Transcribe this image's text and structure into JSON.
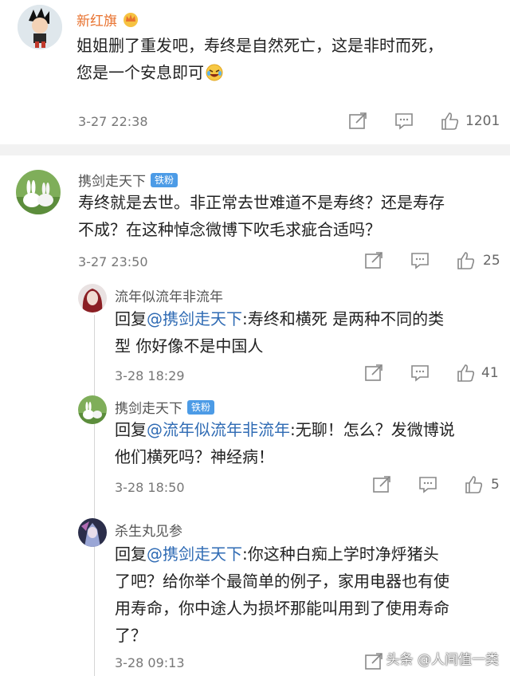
{
  "comments": [
    {
      "username": "新红旗",
      "text_1": "姐姐删了重发吧，寿终是自然死亡，这是非时而死，",
      "text_2": "您是一个安息即可",
      "emoji": "laughing-tears-emoji",
      "time": "3-27 22:38",
      "likes": "1201"
    },
    {
      "username": "携剑走天下",
      "badge": "铁粉",
      "text_1": "寿终就是去世。非正常去世难道不是寿终？还是寿存",
      "text_2": "不成？在这种悼念微博下吹毛求疵合适吗？",
      "time": "3-27 23:50",
      "likes": "25"
    }
  ],
  "replies": [
    {
      "username": "流年似流年非流年",
      "reply_prefix": "回复",
      "mention": "@携剑走天下",
      "text_1": ":寿终和横死 是两种不同的类",
      "text_2": "型 你好像不是中国人",
      "time": "3-28 18:29",
      "likes": "41"
    },
    {
      "username": "携剑走天下",
      "badge": "铁粉",
      "reply_prefix": "回复",
      "mention": "@流年似流年非流年",
      "text_1": ":无聊！怎么？发微博说",
      "text_2": "他们横死吗？神经病！",
      "time": "3-28 18:50",
      "likes": "5"
    },
    {
      "username": "杀生丸见参",
      "reply_prefix": "回复",
      "mention": "@携剑走天下",
      "text_1": ":你这种白痴上学时净烀猪头",
      "text_2": "了吧？给你举个最简单的例子，家用电器也有使",
      "text_3": "用寿命，你中途人为损坏那能叫用到了使用寿命",
      "text_4": "了？",
      "time": "3-28 09:13"
    }
  ],
  "watermark": "头条 @人间值一类",
  "icons": [
    "share-icon",
    "comment-icon",
    "like-icon",
    "crown-icon"
  ],
  "colors": {
    "mention": "#2f6bb4",
    "badge": "#4c9be6",
    "divider": "#f2f2f2"
  }
}
